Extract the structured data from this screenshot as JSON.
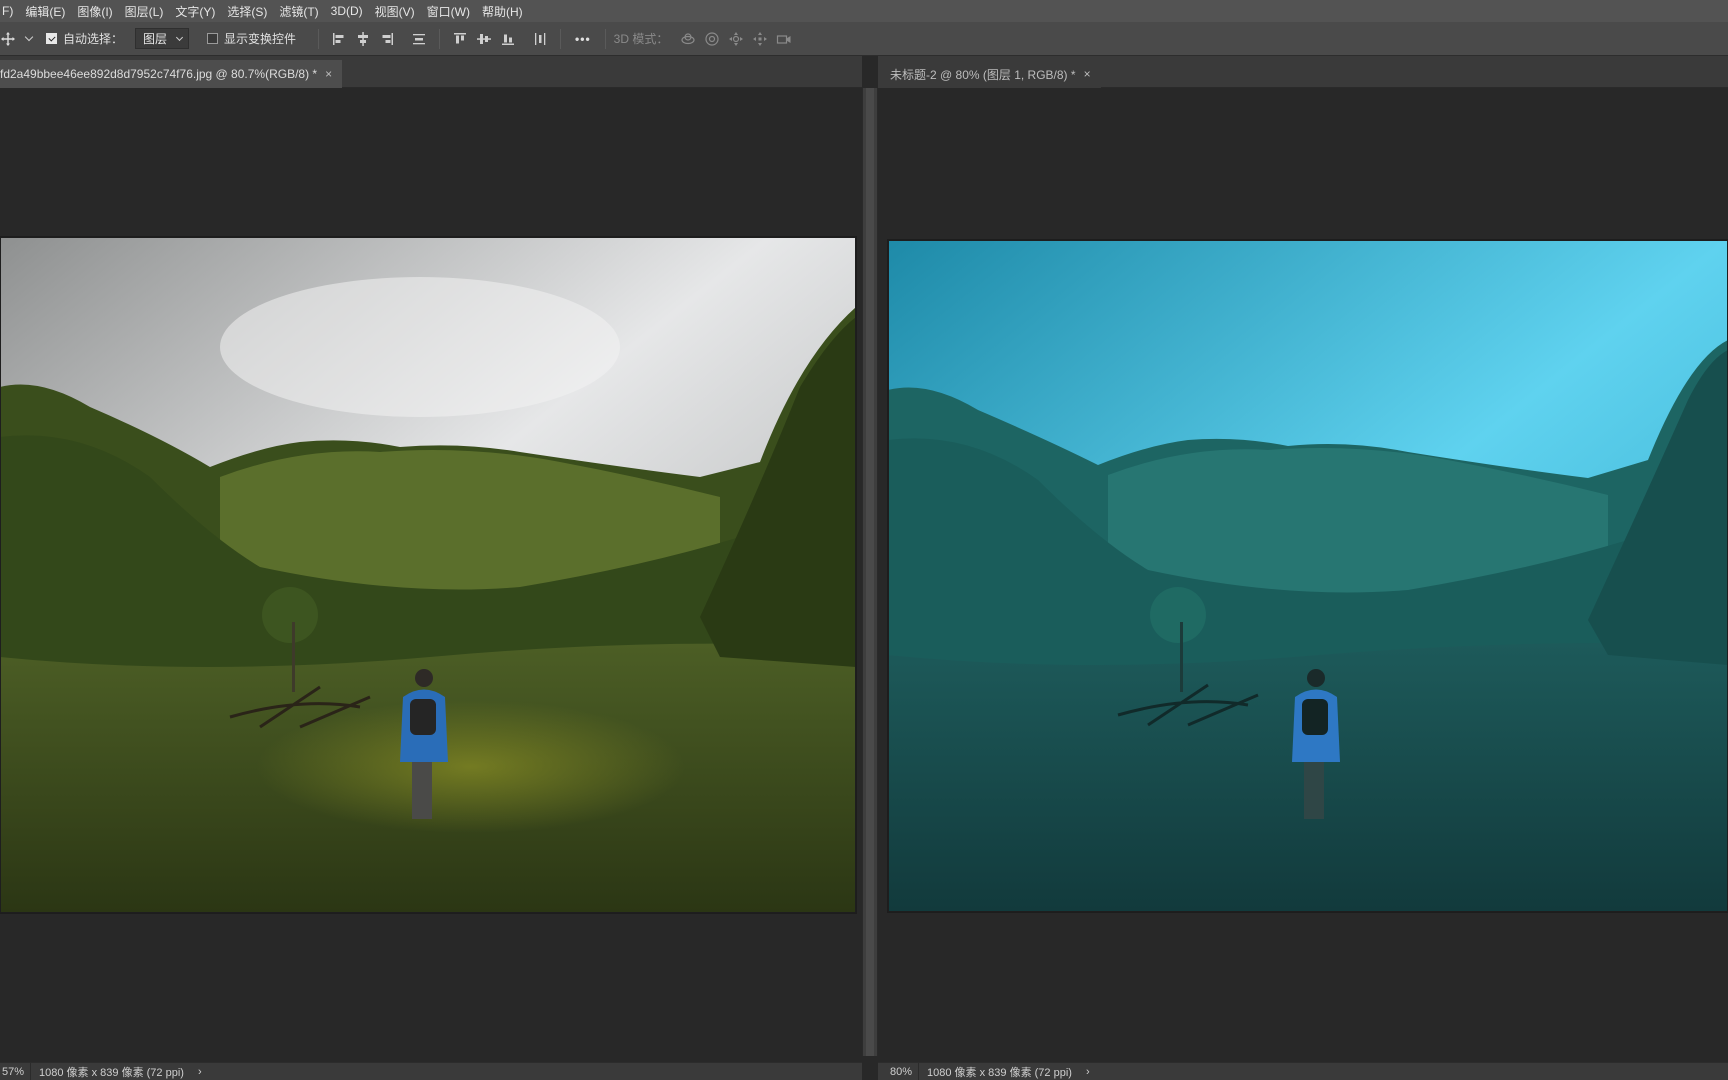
{
  "menu": [
    "F)",
    "编辑(E)",
    "图像(I)",
    "图层(L)",
    "文字(Y)",
    "选择(S)",
    "滤镜(T)",
    "3D(D)",
    "视图(V)",
    "窗口(W)",
    "帮助(H)"
  ],
  "options": {
    "auto_select_label": "自动选择：",
    "auto_select_checked": true,
    "layer_select_value": "图层",
    "show_transform_label": "显示变换控件",
    "more_label": "•••",
    "mode_3d_label": "3D 模式："
  },
  "documents": [
    {
      "tab_title": "fd2a49bbee46ee892d8d7952c74f76.jpg @ 80.7%(RGB/8) *",
      "close": "×",
      "zoom": "57%",
      "info": "1080 像素 x 839 像素 (72 ppi)",
      "status_arrow": "›",
      "style": "original"
    },
    {
      "tab_title": "未标题-2 @ 80% (图层 1, RGB/8) *",
      "close": "×",
      "zoom": "80%",
      "info": "1080 像素 x 839 像素 (72 ppi)",
      "status_arrow": "›",
      "style": "teal"
    }
  ]
}
